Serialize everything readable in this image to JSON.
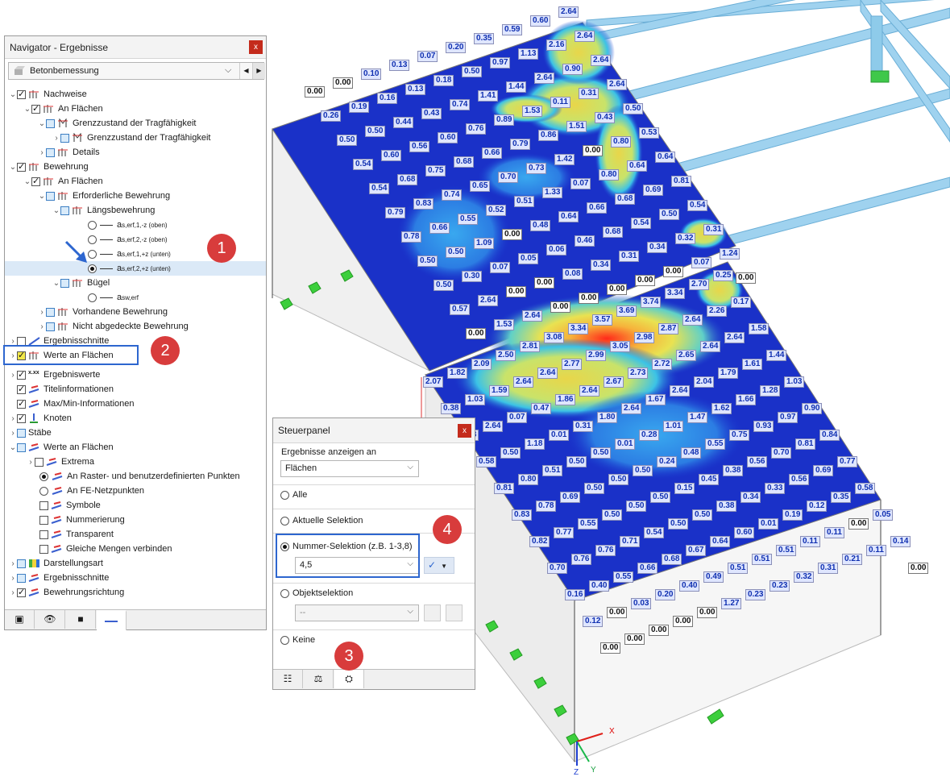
{
  "navigator": {
    "title": "Navigator - Ergebnisse",
    "close": "x",
    "combo": "Betonbemessung",
    "tree": [
      {
        "label": "Nachweise"
      },
      {
        "label": "An Flächen"
      },
      {
        "label": "Grenzzustand der Tragfähigkeit"
      },
      {
        "label": "Grenzzustand der Tragfähigkeit"
      },
      {
        "label": "Details"
      },
      {
        "label": "Bewehrung"
      },
      {
        "label": "An Flächen"
      },
      {
        "label": "Erforderliche Bewehrung"
      },
      {
        "label": "Längsbewehrung"
      },
      {
        "label": "a",
        "sub": "s,erf,1,-z (oben)"
      },
      {
        "label": "a",
        "sub": "s,erf,2,-z (oben)"
      },
      {
        "label": "a",
        "sub": "s,erf,1,+z (unten)"
      },
      {
        "label": "a",
        "sub": "s,erf,2,+z (unten)"
      },
      {
        "label": "Bügel"
      },
      {
        "label": "a",
        "sub": "sw,erf"
      },
      {
        "label": "Vorhandene Bewehrung"
      },
      {
        "label": "Nicht abgedeckte Bewehrung"
      },
      {
        "label": "Ergebnisschnitte"
      },
      {
        "label": "Werte an Flächen"
      },
      {
        "label": "Ergebniswerte"
      },
      {
        "label": "Titelinformationen"
      },
      {
        "label": "Max/Min-Informationen"
      },
      {
        "label": "Knoten"
      },
      {
        "label": "Stäbe"
      },
      {
        "label": "Werte an Flächen"
      },
      {
        "label": "Extrema"
      },
      {
        "label": "An Raster- und benutzerdefinierten Punkten"
      },
      {
        "label": "An FE-Netzpunkten"
      },
      {
        "label": "Symbole"
      },
      {
        "label": "Nummerierung"
      },
      {
        "label": "Transparent"
      },
      {
        "label": "Gleiche Mengen verbinden"
      },
      {
        "label": "Darstellungsart"
      },
      {
        "label": "Ergebnisschnitte"
      },
      {
        "label": "Bewehrungsrichtung"
      }
    ],
    "ergebniswerte_icon_text": "x.xx"
  },
  "badges": [
    "1",
    "2",
    "3",
    "4"
  ],
  "control": {
    "title": "Steuerpanel",
    "close": "x",
    "section_label": "Ergebnisse anzeigen an",
    "show_on": "Flächen",
    "options": [
      "Alle",
      "Aktuelle Selektion",
      "Nummer-Selektion (z.B. 1-3,8)",
      "Objektselektion",
      "Keine"
    ],
    "number_selection": "4,5",
    "object_selection": "--"
  },
  "axes": {
    "x": "X",
    "y": "Y",
    "z": "Z"
  },
  "labels_upper": [
    "2.64",
    "0.60",
    "0.59",
    "0.35",
    "0.20",
    "0.07",
    "0.13",
    "0.10",
    "0.00",
    "0.00",
    "2.64",
    "2.16",
    "1.13",
    "0.97",
    "0.50",
    "0.18",
    "0.13",
    "0.16",
    "0.19",
    "0.26",
    "2.64",
    "0.90",
    "2.64",
    "1.44",
    "1.41",
    "0.74",
    "0.43",
    "0.44",
    "0.50",
    "0.50",
    "2.64",
    "0.31",
    "0.11",
    "1.53",
    "0.89",
    "0.76",
    "0.60",
    "0.56",
    "0.60",
    "0.54",
    "0.50",
    "0.43",
    "1.51",
    "0.86",
    "0.79",
    "0.66",
    "0.68",
    "0.75",
    "0.68",
    "0.54",
    "0.53",
    "0.80",
    "0.00",
    "1.42",
    "0.73",
    "0.70",
    "0.65",
    "0.74",
    "0.83",
    "0.79",
    "0.64",
    "0.64",
    "0.80",
    "0.07",
    "1.33",
    "0.51",
    "0.52",
    "0.55",
    "0.66",
    "0.78",
    "0.81",
    "0.69",
    "0.68",
    "0.66",
    "0.64",
    "0.48",
    "0.00",
    "1.09",
    "0.50",
    "0.50",
    "0.54",
    "0.50",
    "0.54",
    "0.68",
    "0.46",
    "0.06",
    "0.05",
    "0.07",
    "0.30",
    "0.50",
    "0.31",
    "0.32",
    "0.34",
    "0.31",
    "0.34",
    "0.08",
    "0.00",
    "0.00",
    "2.64",
    "0.57",
    "1.24",
    "0.07",
    "0.00",
    "0.00",
    "0.00",
    "0.00",
    "0.00",
    "2.64",
    "1.53",
    "0.00",
    "0.00"
  ],
  "labels_lower": [
    "0.25",
    "2.70",
    "3.34",
    "3.74",
    "3.69",
    "3.57",
    "3.34",
    "3.08",
    "2.81",
    "2.50",
    "2.09",
    "1.82",
    "2.07",
    "0.17",
    "2.26",
    "2.64",
    "2.87",
    "2.98",
    "3.05",
    "2.99",
    "2.77",
    "2.64",
    "2.64",
    "1.59",
    "1.03",
    "0.38",
    "1.58",
    "2.64",
    "2.64",
    "2.65",
    "2.72",
    "2.73",
    "2.67",
    "2.64",
    "1.86",
    "0.47",
    "0.07",
    "2.64",
    "1.28",
    "1.44",
    "1.61",
    "1.79",
    "2.04",
    "2.64",
    "1.67",
    "2.64",
    "1.80",
    "0.31",
    "0.01",
    "1.18",
    "0.50",
    "0.58",
    "1.03",
    "1.28",
    "1.66",
    "1.62",
    "1.47",
    "1.01",
    "0.28",
    "0.01",
    "0.50",
    "0.50",
    "0.51",
    "0.80",
    "0.81",
    "0.90",
    "0.97",
    "0.93",
    "0.75",
    "0.55",
    "0.48",
    "0.24",
    "0.50",
    "0.50",
    "0.50",
    "0.69",
    "0.78",
    "0.83",
    "0.84",
    "0.81",
    "0.70",
    "0.56",
    "0.38",
    "0.45",
    "0.15",
    "0.50",
    "0.50",
    "0.50",
    "0.55",
    "0.77",
    "0.82",
    "0.77",
    "0.69",
    "0.56",
    "0.33",
    "0.34",
    "0.38",
    "0.50",
    "0.50",
    "0.54",
    "0.71",
    "0.76",
    "0.76",
    "0.70",
    "0.58",
    "0.35",
    "0.12",
    "0.19",
    "0.01",
    "0.60",
    "0.64",
    "0.67",
    "0.68",
    "0.66",
    "0.55",
    "0.40",
    "0.16",
    "0.05",
    "0.00",
    "0.11",
    "0.11",
    "0.51",
    "0.51",
    "0.51",
    "0.49",
    "0.40",
    "0.20",
    "0.03",
    "0.00",
    "0.12",
    "0.14",
    "0.11",
    "0.21",
    "0.31",
    "0.32",
    "0.23",
    "0.23",
    "1.27",
    "0.00",
    "0.00",
    "0.00",
    "0.00",
    "0.00",
    "0.00"
  ]
}
